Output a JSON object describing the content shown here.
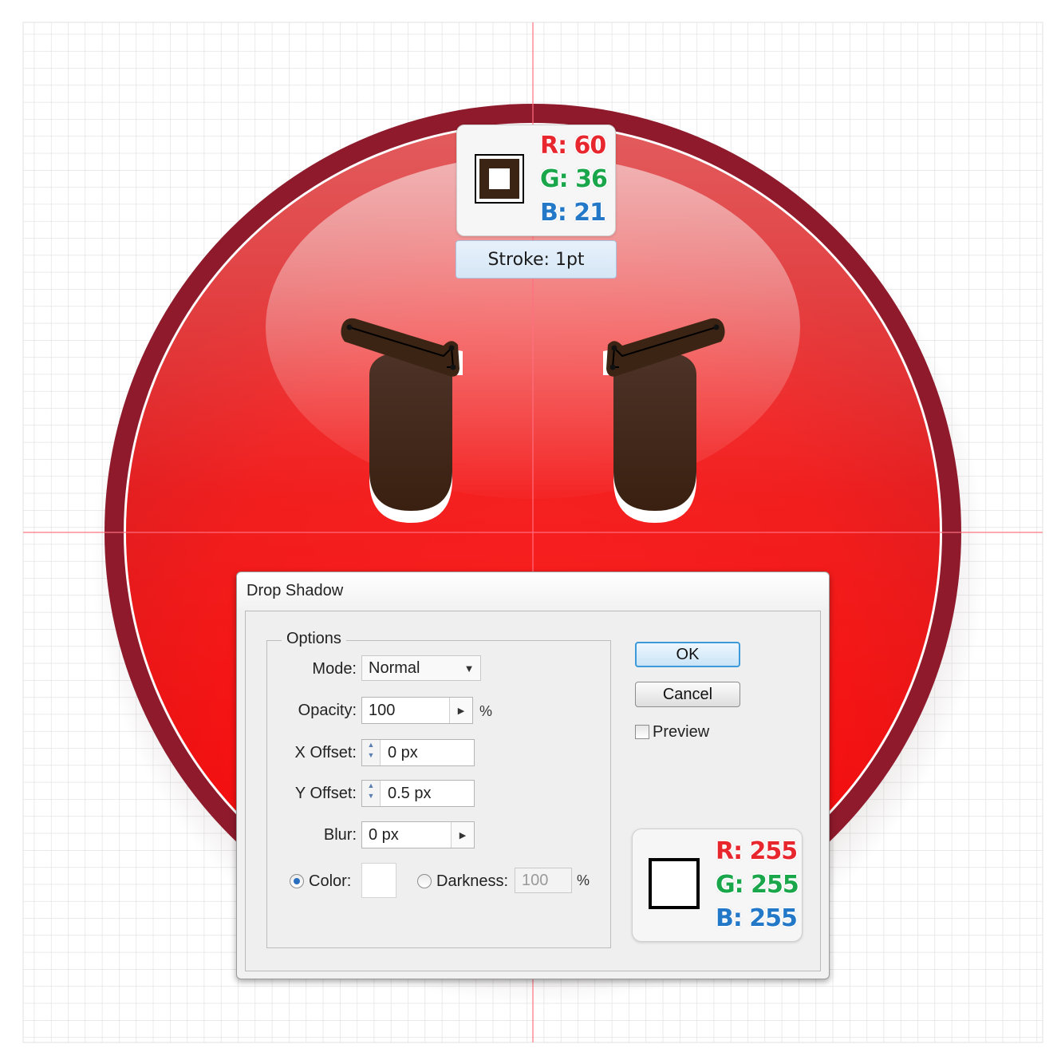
{
  "colors": {
    "face_red": "#ff0a0a",
    "face_rim": "#8c1a2b",
    "eye_brown": "#3c2415",
    "guide_line": "#ff6a7a",
    "grid_line": "#dcdcdc"
  },
  "stroke_tooltip": {
    "r": "R: 60",
    "g": "G: 36",
    "b": "B: 21",
    "label": "Stroke: 1pt",
    "swatch_color": "#3c2415"
  },
  "dialog": {
    "title": "Drop Shadow",
    "options_legend": "Options",
    "mode_label": "Mode:",
    "mode_value": "Normal",
    "opacity_label": "Opacity:",
    "opacity_value": "100",
    "opacity_unit": "%",
    "x_offset_label": "X Offset:",
    "x_offset_value": "0 px",
    "y_offset_label": "Y Offset:",
    "y_offset_value": "0.5 px",
    "blur_label": "Blur:",
    "blur_value": "0 px",
    "color_label": "Color:",
    "color_selected": true,
    "darkness_label": "Darkness:",
    "darkness_value": "100",
    "darkness_unit": "%",
    "ok_label": "OK",
    "cancel_label": "Cancel",
    "preview_label": "Preview",
    "preview_checked": false,
    "color_value": "#ffffff"
  },
  "shadow_color_tooltip": {
    "r": "R: 255",
    "g": "G: 255",
    "b": "B: 255",
    "swatch_color": "#ffffff"
  }
}
